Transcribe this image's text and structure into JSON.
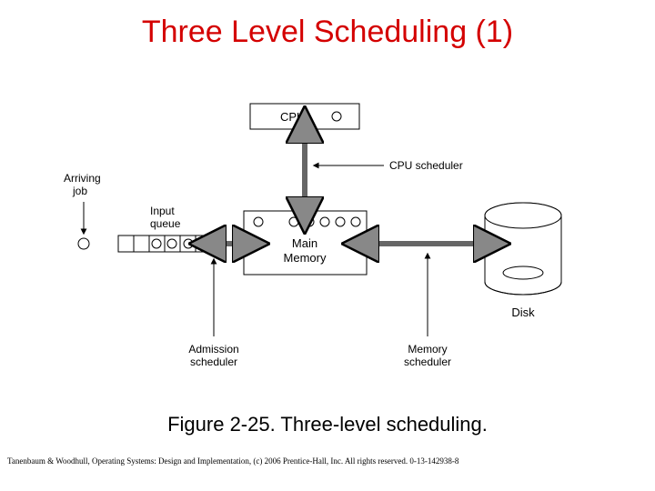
{
  "title": "Three Level Scheduling (1)",
  "caption": "Figure 2-25. Three-level scheduling.",
  "copyright": "Tanenbaum & Woodhull, Operating Systems: Design and Implementation, (c) 2006 Prentice-Hall, Inc. All rights reserved. 0-13-142938-8",
  "labels": {
    "arriving_job_1": "Arriving",
    "arriving_job_2": "job",
    "input_queue_1": "Input",
    "input_queue_2": "queue",
    "cpu": "CPU",
    "cpu_scheduler": "CPU scheduler",
    "main_memory_1": "Main",
    "main_memory_2": "Memory",
    "admission_scheduler_1": "Admission",
    "admission_scheduler_2": "scheduler",
    "memory_scheduler_1": "Memory",
    "memory_scheduler_2": "scheduler",
    "disk": "Disk"
  }
}
